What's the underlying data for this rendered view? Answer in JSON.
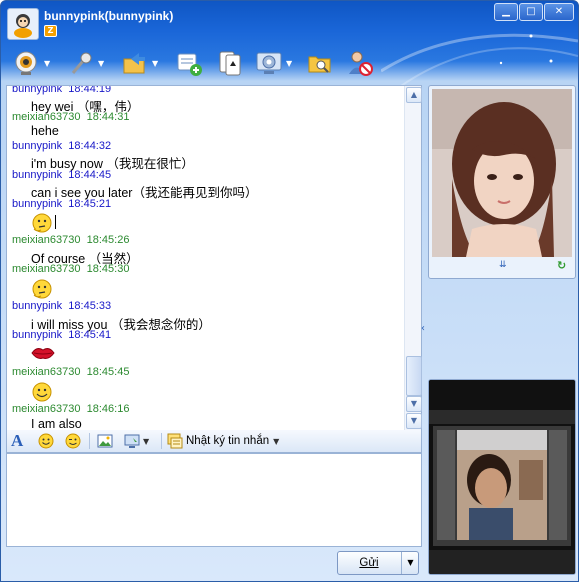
{
  "window": {
    "title": "bunnypink(bunnypink)",
    "status_badge": "Z",
    "buttons": {
      "minimize": "▁",
      "maximize": "□",
      "close": "✕"
    }
  },
  "toolbar": {
    "items": [
      "webcam-icon",
      "microphone-icon",
      "send-file-icon",
      "add-contact-icon",
      "games-icon",
      "settings-icon",
      "open-folder-icon",
      "block-user-icon"
    ]
  },
  "messages": [
    {
      "sender": "bunnypink",
      "time": "18:44:19",
      "text": "hey wei （嘿，伟）"
    },
    {
      "sender": "meixian63730",
      "time": "18:44:31",
      "text": "hehe"
    },
    {
      "sender": "bunnypink",
      "time": "18:44:32",
      "text": "i'm busy now （我现在很忙）"
    },
    {
      "sender": "bunnypink",
      "time": "18:44:45",
      "text": "can i see you later（我还能再见到你吗）"
    },
    {
      "sender": "bunnypink",
      "time": "18:45:21",
      "emoticon": "thinking-emoticon"
    },
    {
      "sender": "meixian63730",
      "time": "18:45:26",
      "text": "Of course （当然）"
    },
    {
      "sender": "meixian63730",
      "time": "18:45:30",
      "emoticon": "thinking-emoticon"
    },
    {
      "sender": "bunnypink",
      "time": "18:45:33",
      "text": "i will miss you （我会想念你的）"
    },
    {
      "sender": "bunnypink",
      "time": "18:45:41",
      "emoticon": "kiss-lips-emoticon"
    },
    {
      "sender": "meixian63730",
      "time": "18:45:45",
      "emoticon": "smile-emoticon"
    },
    {
      "sender": "meixian63730",
      "time": "18:46:16",
      "text": "I am also"
    }
  ],
  "format_bar": {
    "font_icon": "A",
    "message_log_label": "Nhật ký tin nhắn"
  },
  "input": {
    "value": ""
  },
  "send_button": {
    "label": "Gửi"
  },
  "colors": {
    "sender_self": "#1818c8",
    "sender_other": "#2c8a30",
    "title_bar": "#1a66d8"
  }
}
